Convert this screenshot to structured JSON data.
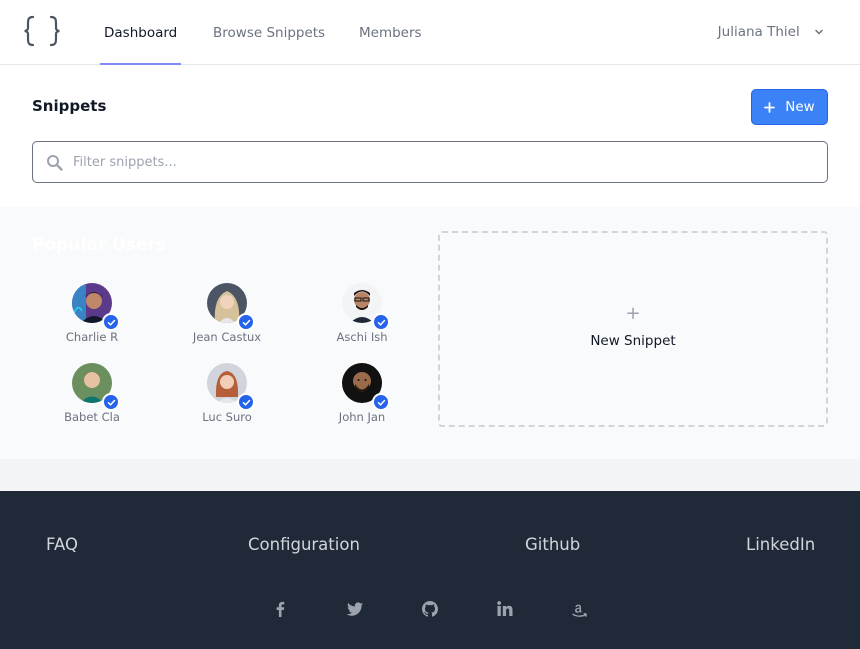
{
  "nav": {
    "tabs": [
      {
        "label": "Dashboard",
        "active": true
      },
      {
        "label": "Browse Snippets",
        "active": false
      },
      {
        "label": "Members",
        "active": false
      }
    ],
    "user_name": "Juliana Thiel"
  },
  "header": {
    "title": "Snippets",
    "new_button_label": "New"
  },
  "search": {
    "placeholder": "Filter snippets..."
  },
  "popular": {
    "title": "Popular Users",
    "users": [
      {
        "name": "Charlie R",
        "verified": true
      },
      {
        "name": "Jean Castux",
        "verified": true
      },
      {
        "name": "Aschi Ish",
        "verified": true
      },
      {
        "name": "Babet Cla",
        "verified": true
      },
      {
        "name": "Luc Suro",
        "verified": true
      },
      {
        "name": "John Jan",
        "verified": true
      }
    ]
  },
  "new_snippet_card": {
    "plus": "+",
    "label": "New Snippet"
  },
  "footer": {
    "links": [
      "FAQ",
      "Configuration",
      "Github",
      "LinkedIn"
    ],
    "social_icons": [
      "facebook-icon",
      "twitter-icon",
      "github-icon",
      "linkedin-icon",
      "amazon-icon"
    ]
  },
  "colors": {
    "accent": "#3b82f6",
    "tab_underline": "#818cf8",
    "footer_bg": "#1f2937",
    "band_bg": "#f9fafb"
  }
}
